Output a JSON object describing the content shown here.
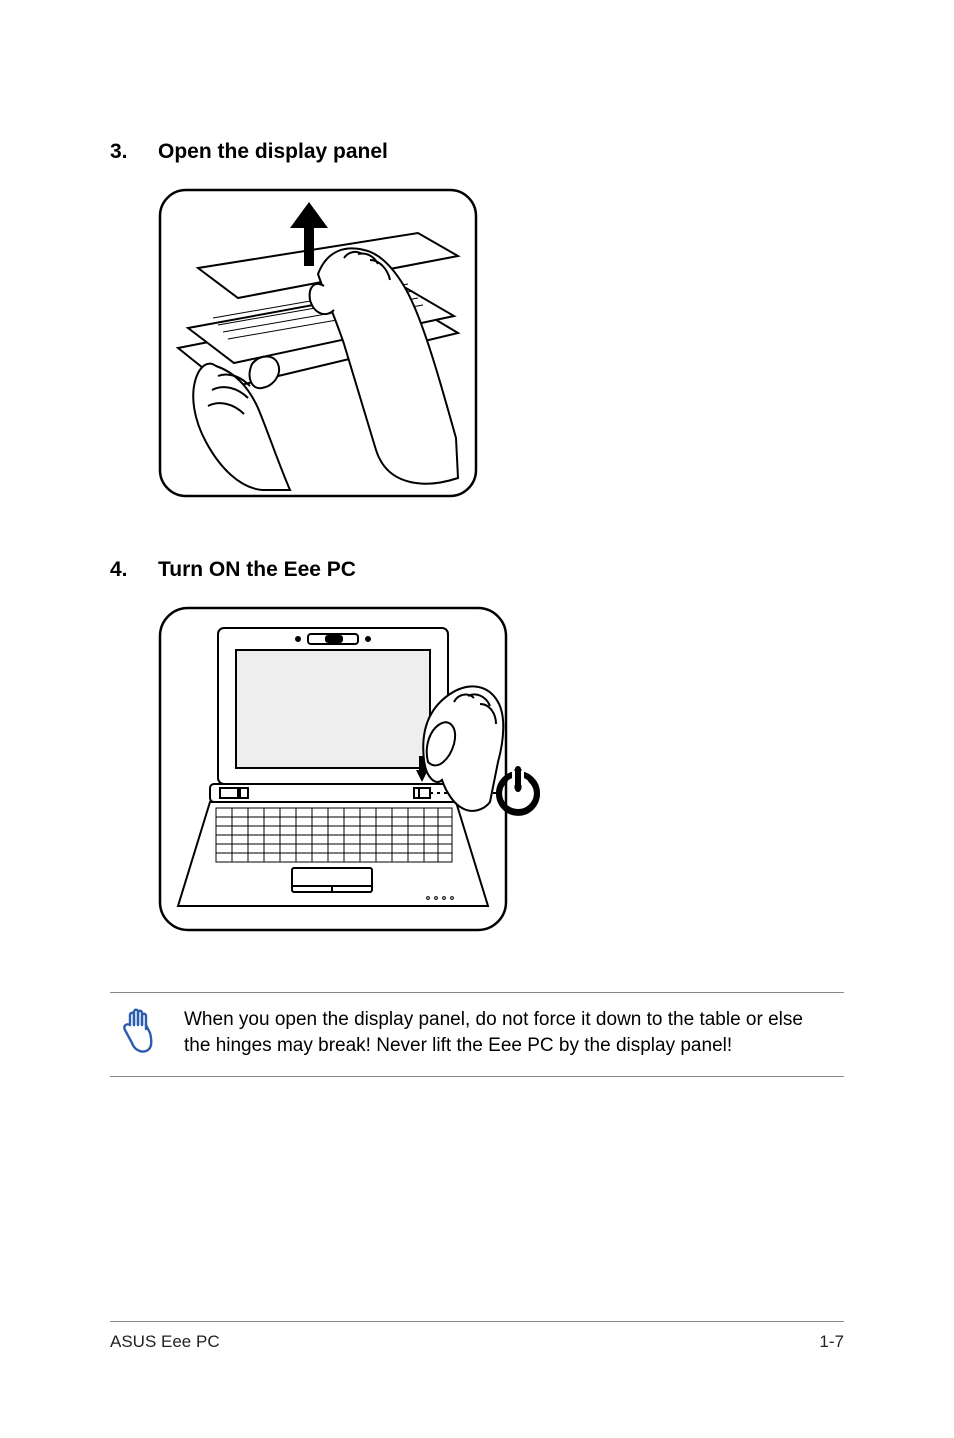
{
  "steps": [
    {
      "num": "3.",
      "title": "Open the display panel"
    },
    {
      "num": "4.",
      "title": "Turn ON the Eee PC"
    }
  ],
  "note": "When you open the display panel, do not force it down to the table or else the hinges may break! Never lift the Eee PC by the display panel!",
  "footer": {
    "left": "ASUS Eee PC",
    "right": "1-7"
  }
}
